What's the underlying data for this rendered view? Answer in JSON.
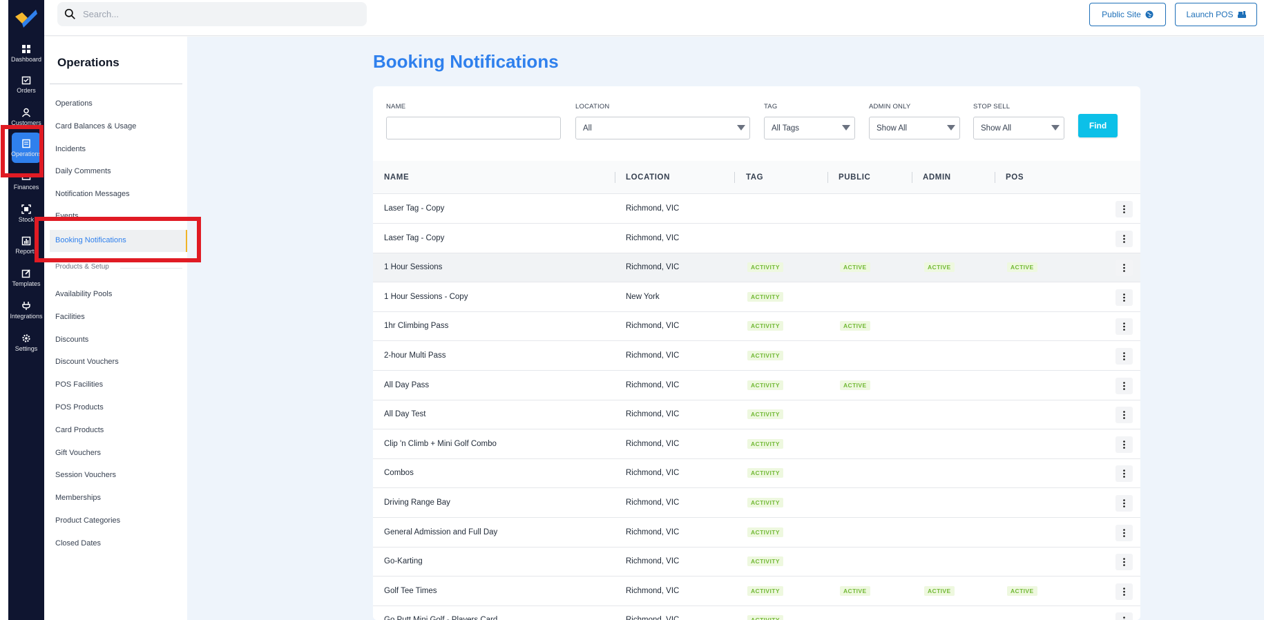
{
  "topbar": {
    "search_placeholder": "Search...",
    "public_site_label": "Public Site",
    "launch_pos_label": "Launch POS"
  },
  "rail": {
    "items": [
      {
        "label": "Dashboard",
        "icon": "dashboard-icon"
      },
      {
        "label": "Orders",
        "icon": "orders-icon"
      },
      {
        "label": "Customers",
        "icon": "customers-icon"
      },
      {
        "label": "Operations",
        "icon": "operations-icon"
      },
      {
        "label": "Finances",
        "icon": "finances-icon"
      },
      {
        "label": "Stock",
        "icon": "stock-icon"
      },
      {
        "label": "Reports",
        "icon": "reports-icon"
      },
      {
        "label": "Templates",
        "icon": "templates-icon"
      },
      {
        "label": "Integrations",
        "icon": "integrations-icon"
      },
      {
        "label": "Settings",
        "icon": "settings-icon"
      }
    ],
    "active": "Operations"
  },
  "subnav": {
    "title": "Operations",
    "items": [
      "Operations",
      "Card Balances & Usage",
      "Incidents",
      "Daily Comments",
      "Notification Messages",
      "Events"
    ],
    "active_item": "Booking Notifications",
    "section_label": "Products & Setup",
    "setup_items": [
      "Availability Pools",
      "Facilities",
      "Discounts",
      "Discount Vouchers",
      "POS Facilities",
      "POS Products",
      "Card Products",
      "Gift Vouchers",
      "Session Vouchers",
      "Memberships",
      "Product Categories",
      "Closed Dates"
    ]
  },
  "page": {
    "title": "Booking Notifications"
  },
  "filters": {
    "name_label": "NAME",
    "name_value": "",
    "location_label": "LOCATION",
    "location_value": "All",
    "tag_label": "TAG",
    "tag_value": "All Tags",
    "admin_only_label": "ADMIN ONLY",
    "admin_only_value": "Show All",
    "stop_sell_label": "STOP SELL",
    "stop_sell_value": "Show All",
    "find_label": "Find"
  },
  "table": {
    "columns": [
      "NAME",
      "LOCATION",
      "TAG",
      "PUBLIC",
      "ADMIN",
      "POS"
    ],
    "rows": [
      {
        "name": "Laser Tag - Copy",
        "location": "Richmond, VIC",
        "tag": "",
        "public": "",
        "admin": "",
        "pos": ""
      },
      {
        "name": "Laser Tag - Copy",
        "location": "Richmond, VIC",
        "tag": "",
        "public": "",
        "admin": "",
        "pos": ""
      },
      {
        "name": "1 Hour Sessions",
        "location": "Richmond, VIC",
        "tag": "ACTIVITY",
        "public": "ACTIVE",
        "admin": "ACTIVE",
        "pos": "ACTIVE"
      },
      {
        "name": "1 Hour Sessions - Copy",
        "location": "New York",
        "tag": "ACTIVITY",
        "public": "",
        "admin": "",
        "pos": ""
      },
      {
        "name": "1hr Climbing Pass",
        "location": "Richmond, VIC",
        "tag": "ACTIVITY",
        "public": "ACTIVE",
        "admin": "",
        "pos": ""
      },
      {
        "name": "2-hour Multi Pass",
        "location": "Richmond, VIC",
        "tag": "ACTIVITY",
        "public": "",
        "admin": "",
        "pos": ""
      },
      {
        "name": "All Day Pass",
        "location": "Richmond, VIC",
        "tag": "ACTIVITY",
        "public": "ACTIVE",
        "admin": "",
        "pos": ""
      },
      {
        "name": "All Day Test",
        "location": "Richmond, VIC",
        "tag": "ACTIVITY",
        "public": "",
        "admin": "",
        "pos": ""
      },
      {
        "name": "Clip 'n Climb + Mini Golf Combo",
        "location": "Richmond, VIC",
        "tag": "ACTIVITY",
        "public": "",
        "admin": "",
        "pos": ""
      },
      {
        "name": "Combos",
        "location": "Richmond, VIC",
        "tag": "ACTIVITY",
        "public": "",
        "admin": "",
        "pos": ""
      },
      {
        "name": "Driving Range Bay",
        "location": "Richmond, VIC",
        "tag": "ACTIVITY",
        "public": "",
        "admin": "",
        "pos": ""
      },
      {
        "name": "General Admission and Full Day",
        "location": "Richmond, VIC",
        "tag": "ACTIVITY",
        "public": "",
        "admin": "",
        "pos": ""
      },
      {
        "name": "Go-Karting",
        "location": "Richmond, VIC",
        "tag": "ACTIVITY",
        "public": "",
        "admin": "",
        "pos": ""
      },
      {
        "name": "Golf Tee Times",
        "location": "Richmond, VIC",
        "tag": "ACTIVITY",
        "public": "ACTIVE",
        "admin": "ACTIVE",
        "pos": "ACTIVE"
      },
      {
        "name": "Go Putt Mini Golf - Players Card",
        "location": "Richmond, VIC",
        "tag": "ACTIVITY",
        "public": "",
        "admin": "",
        "pos": ""
      }
    ]
  },
  "colors": {
    "rail_bg": "#0f1530",
    "accent": "#2f80ed",
    "find_button": "#0cc0e8",
    "pill_text": "#72b935",
    "pill_bg": "#eef8df",
    "annotation_red": "#e01b24",
    "active_marker": "#f0b429"
  }
}
